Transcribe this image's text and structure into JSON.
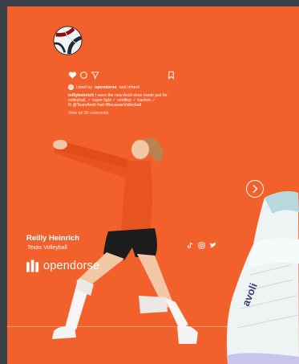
{
  "post": {
    "username": "reillyheinrich",
    "liked_prefix": "Liked by",
    "liked_by": "opendorse",
    "liked_suffix": "and others",
    "caption_line1": "I wore the new Avoli shoe made just for",
    "caption_line2": "volleyball. ✓ super light ✓ ventilep ✓ traction ✓",
    "caption_line3": "fit @TeamAvoli #ad #BecauseVolleyball",
    "comments": "View all 28 comments"
  },
  "athlete": {
    "name": "Reilly Heinrich",
    "team": "Texas Volleyball"
  },
  "brand": {
    "name": "opendorse"
  },
  "icons": {
    "heart": "heart-icon",
    "comment": "comment-icon",
    "share": "send-icon",
    "save": "bookmark-icon",
    "tiktok": "tiktok-icon",
    "instagram": "instagram-icon",
    "twitter": "twitter-icon",
    "next": "chevron-right-icon"
  },
  "colors": {
    "background": "#f2612c",
    "jersey": "#e8541f",
    "shorts": "#1c1c1c",
    "shoe": "#eaf1f2",
    "frame": "#3a4147"
  }
}
